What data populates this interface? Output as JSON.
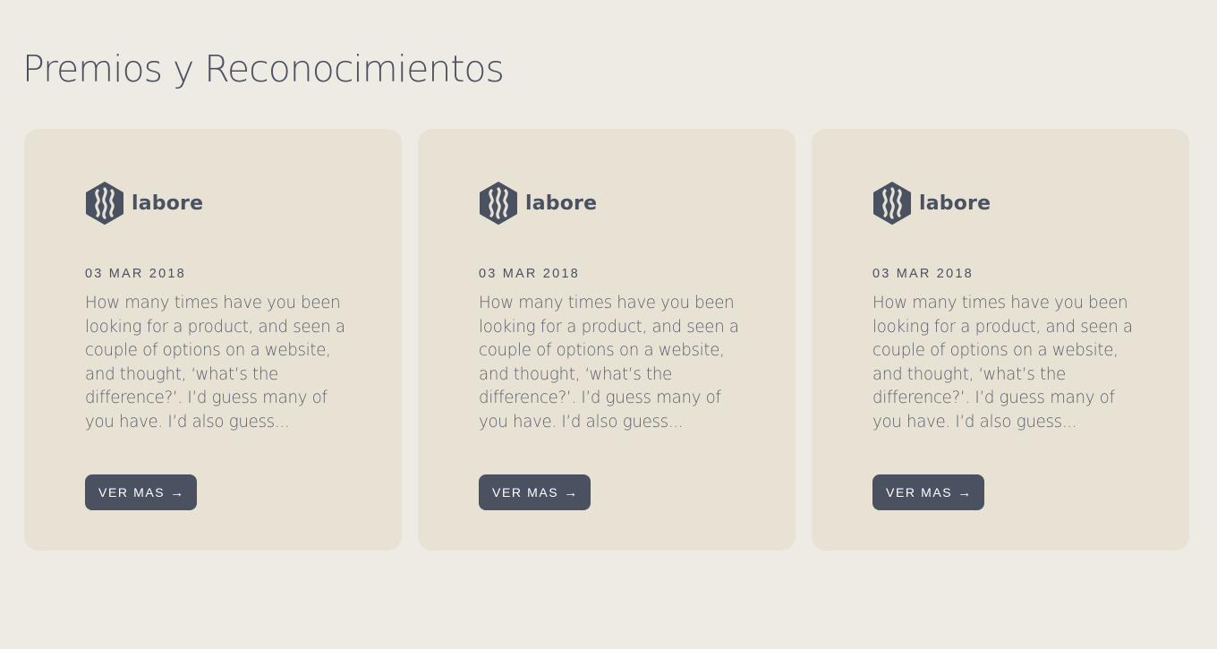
{
  "section": {
    "title": "Premios y Reconocimientos"
  },
  "colors": {
    "background": "#EDEBE4",
    "card": "#E8E2D5",
    "text": "#4A5160",
    "button": "#4A5160"
  },
  "cards": [
    {
      "logo_icon": "labore-hexagon-logo-icon",
      "logo_text": "labore",
      "date": "03 MAR 2018",
      "description": "How many times have you been looking for a product, and seen a couple of options on a website, and thought, ‘what’s the difference?’. I’d guess many of you have. I’d also guess...",
      "button_label": "VER MAS",
      "button_icon": "arrow-right-icon"
    },
    {
      "logo_icon": "labore-hexagon-logo-icon",
      "logo_text": "labore",
      "date": "03 MAR 2018",
      "description": "How many times have you been looking for a product, and seen a couple of options on a website, and thought, ‘what’s the difference?’. I’d guess many of you have. I’d also guess...",
      "button_label": "VER MAS",
      "button_icon": "arrow-right-icon"
    },
    {
      "logo_icon": "labore-hexagon-logo-icon",
      "logo_text": "labore",
      "date": "03 MAR 2018",
      "description": "How many times have you been looking for a product, and seen a couple of options on a website, and thought, ‘what’s the difference?’. I’d guess many of you have. I’d also guess...",
      "button_label": "VER MAS",
      "button_icon": "arrow-right-icon"
    }
  ]
}
